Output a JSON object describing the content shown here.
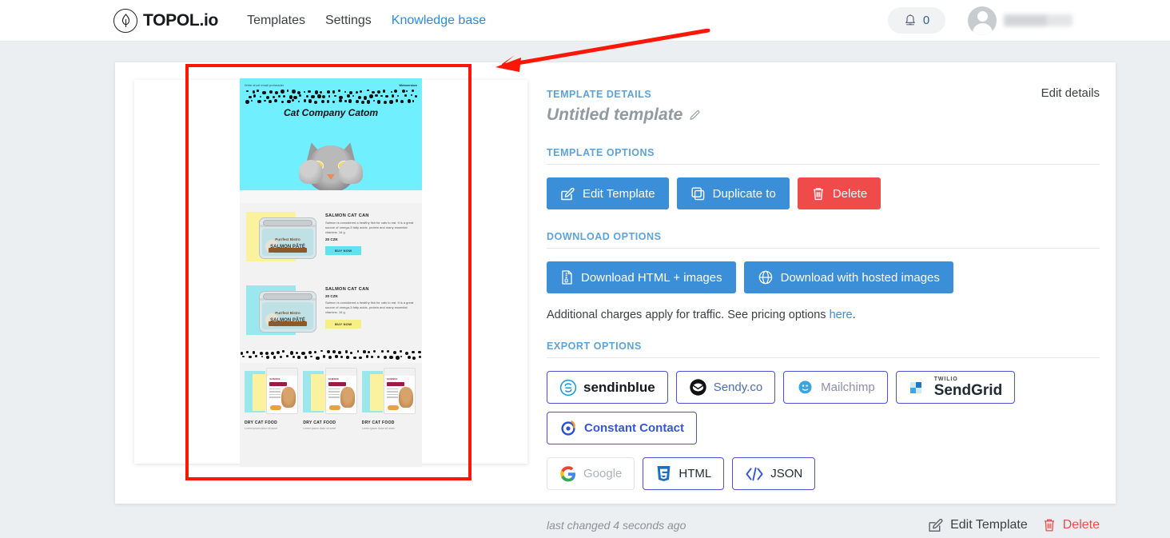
{
  "nav": {
    "brand": "TOPOL.io",
    "links": [
      {
        "label": "Templates",
        "active": false
      },
      {
        "label": "Settings",
        "active": false
      },
      {
        "label": "Knowledge base",
        "active": true
      }
    ],
    "notification_count": "0",
    "avatar_name_redacted": ""
  },
  "details": {
    "section_template_details": "TEMPLATE DETAILS",
    "edit_details_link": "Edit details",
    "template_name": "Untitled template",
    "section_template_options": "TEMPLATE OPTIONS",
    "section_download_options": "DOWNLOAD OPTIONS",
    "section_export_options": "EXPORT OPTIONS",
    "buttons": {
      "edit_template": "Edit Template",
      "duplicate_to": "Duplicate to",
      "delete": "Delete",
      "download_html_images": "Download HTML + images",
      "download_hosted_images": "Download with hosted images"
    },
    "traffic_note": "Additional charges apply for traffic. See pricing options ",
    "traffic_note_link": "here",
    "traffic_note_end": ".",
    "export_chips": [
      {
        "label": "sendinblue",
        "icon": "sendinblue-icon",
        "muted": false
      },
      {
        "label": "Sendy.co",
        "icon": "sendy-icon",
        "muted": false
      },
      {
        "label": "Mailchimp",
        "icon": "mailchimp-icon",
        "muted": false
      },
      {
        "label": "SendGrid",
        "icon": "sendgrid-icon",
        "sup": "TWILIO",
        "muted": false
      },
      {
        "label": "Constant Contact",
        "icon": "constant-contact-icon",
        "muted": false
      },
      {
        "label": "Google",
        "icon": "google-icon",
        "muted": true
      },
      {
        "label": "HTML",
        "icon": "html5-icon",
        "muted": false
      },
      {
        "label": "JSON",
        "icon": "code-brackets-icon",
        "muted": false
      }
    ],
    "last_changed": "last changed 4 seconds ago",
    "footer_edit": "Edit Template",
    "footer_delete": "Delete"
  },
  "preview": {
    "preheader": "Write short email preheader",
    "webversion": "Webversion",
    "email_title": "Cat Company Catom",
    "products": [
      {
        "title": "SALMON CAT CAN",
        "desc": "Salmon is considered a healthy fish for cats to eat. It is a great source of omega-3 fatty acids, protein and many essential vitamins. 16 g",
        "price": "20 CZK",
        "buy_label": "BUY NOW",
        "sticky_color": "yellow",
        "button_color": "cyan",
        "can_brand": "Purrfect Bistro",
        "can_name": "SALMON PÂTÉ",
        "order": "desc_first"
      },
      {
        "title": "SALMON CAT CAN",
        "desc": "Salmon is considered a healthy fish for cats to eat. It is a great source of omega-3 fatty acids, protein and many essential vitamins. 16 g",
        "price": "20 CZK",
        "buy_label": "BUY NOW",
        "sticky_color": "cyan",
        "button_color": "yellow",
        "can_brand": "Purrfect Bistro",
        "can_name": "SALMON PÂTÉ",
        "order": "price_first"
      }
    ],
    "dry_items": [
      {
        "title": "DRY CAT FOOD",
        "desc": "Lorem ipsum dolor sit amet"
      },
      {
        "title": "DRY CAT FOOD",
        "desc": "Lorem ipsum dolor sit amet"
      },
      {
        "title": "DRY CAT FOOD",
        "desc": "Lorem ipsum dolor sit amet"
      }
    ]
  },
  "annotation": {
    "highlight_color": "#fb1605",
    "arrow_color": "#fb1605"
  }
}
